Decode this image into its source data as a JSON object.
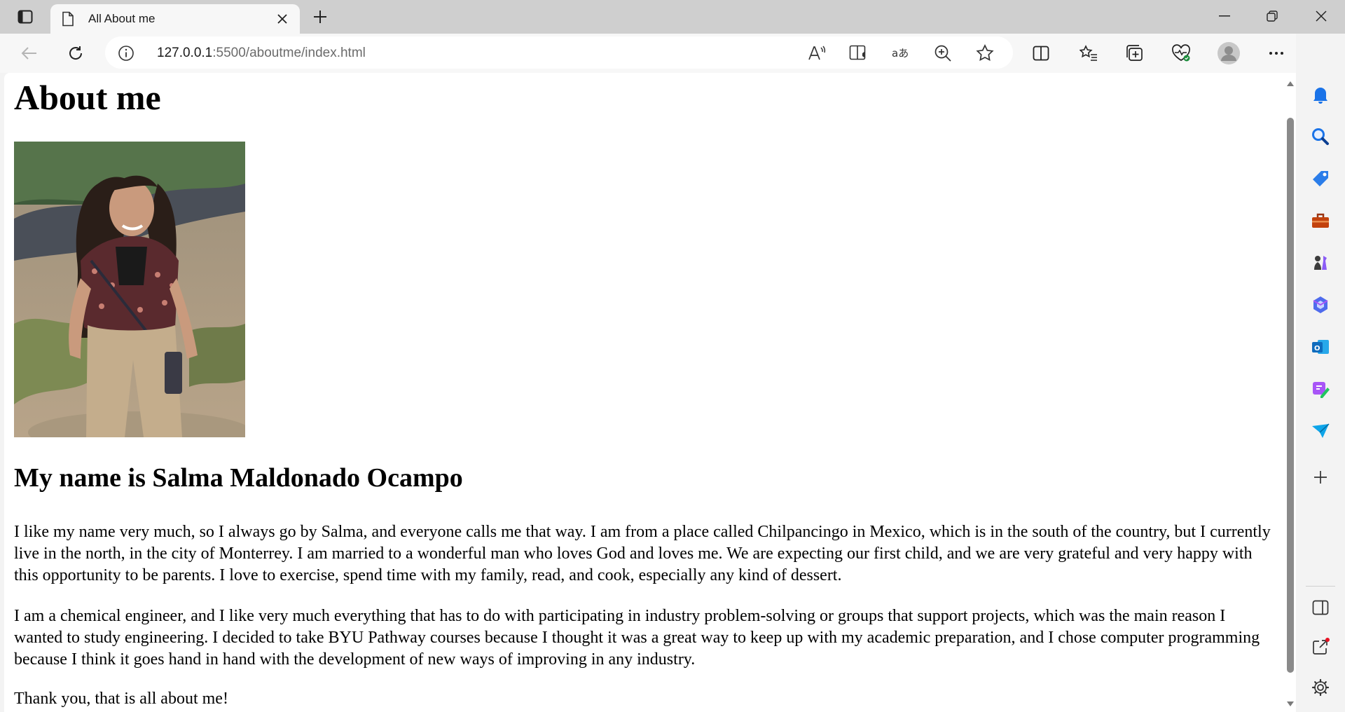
{
  "browser": {
    "tab": {
      "title": "All About me"
    },
    "address": {
      "host": "127.0.0.1",
      "rest": ":5500/aboutme/index.html"
    }
  },
  "page": {
    "heading": "About me",
    "photo_alt": "Photo of a smiling woman standing outdoors",
    "subheading": "My name is Salma Maldonado Ocampo",
    "paragraph1": "I like my name very much, so I always go by Salma, and everyone calls me that way. I am from a place called Chilpancingo in Mexico, which is in the south of the country, but I currently live in the north, in the city of Monterrey. I am married to a wonderful man who loves God and loves me. We are expecting our first child, and we are very grateful and very happy with this opportunity to be parents. I love to exercise, spend time with my family, read, and cook, especially any kind of dessert.",
    "paragraph2": "I am a chemical engineer, and I like very much everything that has to do with participating in industry problem-solving or groups that support projects, which was the main reason I wanted to study engineering. I decided to take BYU Pathway courses because I thought it was a great way to keep up with my academic preparation, and I chose computer programming because I think it goes hand in hand with the development of new ways of improving in any industry.",
    "paragraph3": "Thank you, that is all about me!"
  },
  "colors": {
    "bing_blue": "#1a73e8",
    "notification_dot": "#e81123",
    "shopping_tag": "#2b7de9",
    "tools_case": "#c2410c",
    "outlook_blue": "#0f6cbd"
  }
}
